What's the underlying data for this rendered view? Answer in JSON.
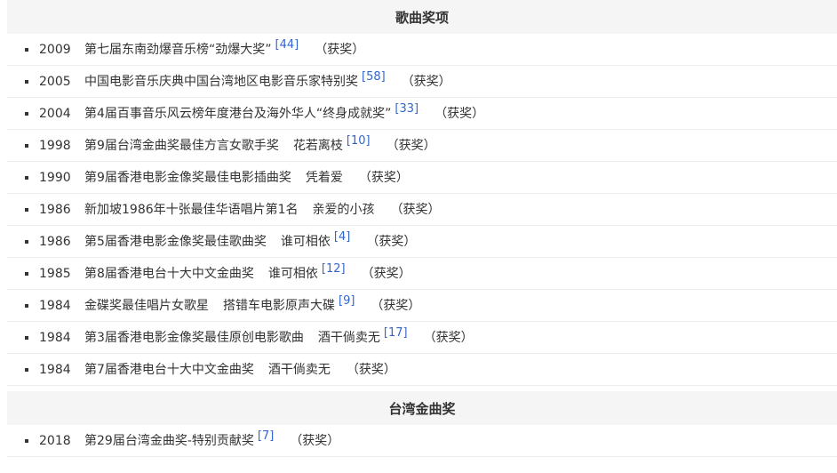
{
  "sections": [
    {
      "title": "歌曲奖项",
      "rows": [
        {
          "year": "2009",
          "title": "第七届东南劲爆音乐榜“劲爆大奖”",
          "work": "",
          "ref": "[44]",
          "result": "（获奖）"
        },
        {
          "year": "2005",
          "title": "中国电影音乐庆典中国台湾地区电影音乐家特别奖",
          "work": "",
          "ref": "[58]",
          "result": "（获奖）"
        },
        {
          "year": "2004",
          "title": "第4届百事音乐风云榜年度港台及海外华人“终身成就奖”",
          "work": "",
          "ref": "[33]",
          "result": "（获奖）"
        },
        {
          "year": "1998",
          "title": "第9届台湾金曲奖最佳方言女歌手奖",
          "work": "花若离枝",
          "ref": "[10]",
          "result": "（获奖）"
        },
        {
          "year": "1990",
          "title": "第9届香港电影金像奖最佳电影插曲奖",
          "work": "凭着爱",
          "ref": "",
          "result": "（获奖）"
        },
        {
          "year": "1986",
          "title": "新加坡1986年十张最佳华语唱片第1名",
          "work": "亲爱的小孩",
          "ref": "",
          "result": "（获奖）"
        },
        {
          "year": "1986",
          "title": "第5届香港电影金像奖最佳歌曲奖",
          "work": "谁可相依",
          "ref": "[4]",
          "result": "（获奖）"
        },
        {
          "year": "1985",
          "title": "第8届香港电台十大中文金曲奖",
          "work": "谁可相依",
          "ref": "[12]",
          "result": "（获奖）"
        },
        {
          "year": "1984",
          "title": "金碟奖最佳唱片女歌星",
          "work": "搭错车电影原声大碟",
          "ref": "[9]",
          "result": "（获奖）"
        },
        {
          "year": "1984",
          "title": "第3届香港电影金像奖最佳原创电影歌曲",
          "work": "酒干倘卖无",
          "ref": "[17]",
          "result": "（获奖）"
        },
        {
          "year": "1984",
          "title": "第7届香港电台十大中文金曲奖",
          "work": "酒干倘卖无",
          "ref": "",
          "result": "（获奖）"
        }
      ]
    },
    {
      "title": "台湾金曲奖",
      "rows": [
        {
          "year": "2018",
          "title": "第29届台湾金曲奖-特别贡献奖",
          "work": "",
          "ref": "[7]",
          "result": "（获奖）"
        }
      ]
    }
  ]
}
